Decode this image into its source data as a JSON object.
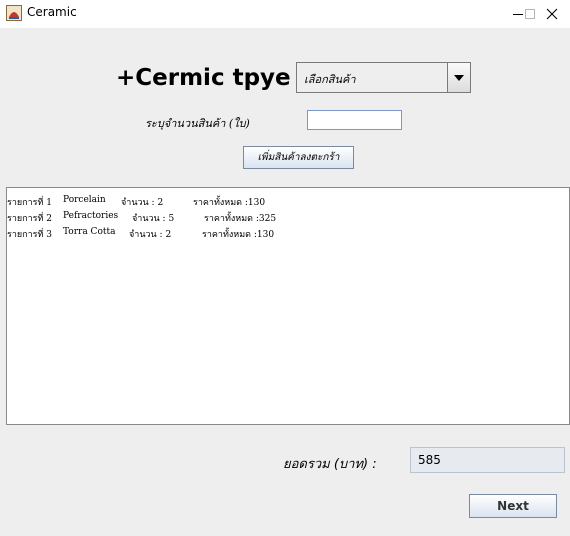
{
  "window": {
    "title": "Ceramic",
    "controls": {
      "minimize": "minimize-icon",
      "maximize": "maximize-icon",
      "close": "close-icon"
    }
  },
  "header": {
    "title": "+Cermic tpye"
  },
  "product_select": {
    "selected": "เลือกสินค้า"
  },
  "quantity": {
    "label": "ระบุจำนวนสินค้า (ใบ)",
    "value": ""
  },
  "add_button": {
    "label": "เพิ่มสินค้าลงตะกร้า"
  },
  "cart": {
    "items": [
      {
        "item": "รายการที่ 1",
        "name": "Porcelain",
        "qty": "จำนวน : 2",
        "total": "ราคาทั้งหมด :130"
      },
      {
        "item": "รายการที่ 2",
        "name": "Pefractories",
        "qty": "จำนวน : 5",
        "total": "ราคาทั้งหมด :325"
      },
      {
        "item": "รายการที่ 3",
        "name": "Torra Cotta",
        "qty": "จำนวน : 2",
        "total": "ราคาทั้งหมด :130"
      }
    ]
  },
  "summary": {
    "label": "ยอดรวม (บาท) :",
    "value": "585"
  },
  "next_button": {
    "label": "Next"
  }
}
